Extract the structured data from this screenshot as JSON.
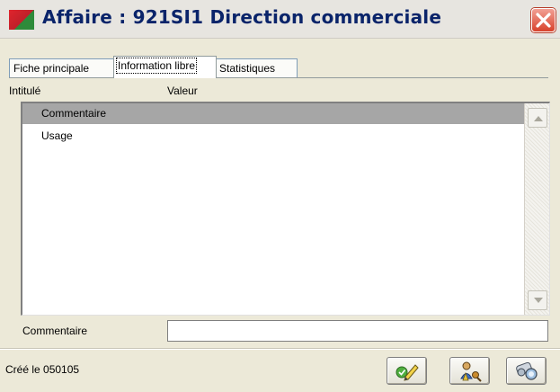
{
  "window": {
    "title": "Affaire : 921SI1 Direction commerciale",
    "app_icon": "red-green-flag-icon",
    "close_icon": "close-icon"
  },
  "tabs": [
    {
      "label": "Fiche principale",
      "active": false
    },
    {
      "label": "Information libre",
      "active": true
    },
    {
      "label": "Statistiques",
      "active": false
    }
  ],
  "list": {
    "columns": [
      "Intitulé",
      "Valeur"
    ],
    "rows": [
      {
        "label": "Commentaire",
        "value": "",
        "selected": true
      },
      {
        "label": "Usage",
        "value": "",
        "selected": false
      }
    ]
  },
  "comment": {
    "label": "Commentaire",
    "value": ""
  },
  "footer": {
    "created_text": "Créé le  050105",
    "buttons": [
      {
        "icon": "edit-pencil-icon"
      },
      {
        "icon": "user-key-icon"
      },
      {
        "icon": "search-binoculars-icon"
      }
    ]
  },
  "colors": {
    "title_text": "#0a246a",
    "selected_row": "#a6a6a6",
    "close_button": "#d8422c",
    "window_bg": "#ece9d8"
  }
}
